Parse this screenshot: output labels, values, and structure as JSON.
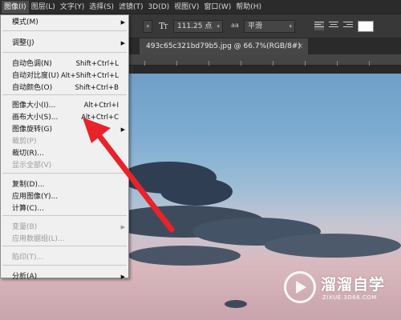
{
  "menubar": {
    "items": [
      "图像(I)",
      "图层(L)",
      "文字(Y)",
      "选择(S)",
      "滤镜(T)",
      "3D(D)",
      "视图(V)",
      "窗口(W)",
      "帮助(H)"
    ]
  },
  "options_bar": {
    "font_size": "111.25 点",
    "antialias_label": "a",
    "antialias_value": "平滑",
    "color_swatch": "#ffffff"
  },
  "document_tab": {
    "title": "493c65c321bd79b5.jpg @ 66.7%(RGB/8#)",
    "close": "×"
  },
  "image_menu": {
    "items": [
      {
        "label": "模式(M)",
        "shortcut": "",
        "submenu": true,
        "disabled": false
      },
      {
        "label": "调整(J)",
        "shortcut": "",
        "submenu": true,
        "disabled": false
      },
      {
        "label": "自动色调(N)",
        "shortcut": "Shift+Ctrl+L",
        "submenu": false,
        "disabled": false
      },
      {
        "label": "自动对比度(U)",
        "shortcut": "Alt+Shift+Ctrl+L",
        "submenu": false,
        "disabled": false
      },
      {
        "label": "自动颜色(O)",
        "shortcut": "Shift+Ctrl+B",
        "submenu": false,
        "disabled": false
      },
      {
        "label": "图像大小(I)...",
        "shortcut": "Alt+Ctrl+I",
        "submenu": false,
        "disabled": false
      },
      {
        "label": "画布大小(S)...",
        "shortcut": "Alt+Ctrl+C",
        "submenu": false,
        "disabled": false
      },
      {
        "label": "图像旋转(G)",
        "shortcut": "",
        "submenu": true,
        "disabled": false
      },
      {
        "label": "裁剪(P)",
        "shortcut": "",
        "submenu": false,
        "disabled": true
      },
      {
        "label": "裁切(R)...",
        "shortcut": "",
        "submenu": false,
        "disabled": false
      },
      {
        "label": "显示全部(V)",
        "shortcut": "",
        "submenu": false,
        "disabled": true
      },
      {
        "label": "复制(D)...",
        "shortcut": "",
        "submenu": false,
        "disabled": false
      },
      {
        "label": "应用图像(Y)...",
        "shortcut": "",
        "submenu": false,
        "disabled": false
      },
      {
        "label": "计算(C)...",
        "shortcut": "",
        "submenu": false,
        "disabled": false
      },
      {
        "label": "变量(B)",
        "shortcut": "",
        "submenu": true,
        "disabled": true
      },
      {
        "label": "应用数据组(L)...",
        "shortcut": "",
        "submenu": false,
        "disabled": true
      },
      {
        "label": "陷印(T)...",
        "shortcut": "",
        "submenu": false,
        "disabled": true
      },
      {
        "label": "分析(A)",
        "shortcut": "",
        "submenu": true,
        "disabled": false
      }
    ]
  },
  "watermark": {
    "name": "溜溜自学",
    "url": "ZIXUE.3D66.COM"
  },
  "annotation": {
    "arrow_color": "#e8232a"
  }
}
